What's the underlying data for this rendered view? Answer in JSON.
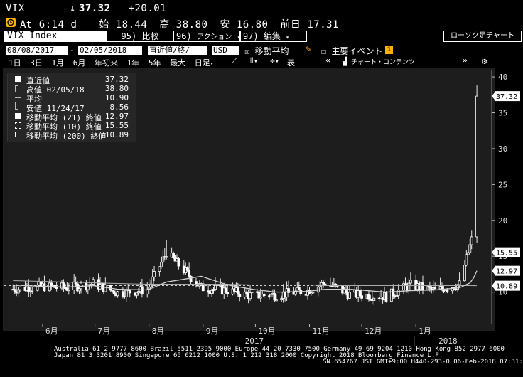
{
  "header": {
    "ticker": "VIX",
    "last_arrow": "↓",
    "last": "37.32",
    "change": "+20.01",
    "clock_icon": "clock-icon",
    "at_label": "At",
    "time": "6:14 d",
    "open_label": "始",
    "open": "18.44",
    "high_label": "高",
    "high": "38.80",
    "low_label": "安",
    "low": "16.80",
    "prev_label": "前日",
    "prev": "17.31"
  },
  "toolbar1": {
    "security": "VIX Index",
    "compare_num": "95)",
    "compare_label": "比較",
    "action_num": "96)",
    "action_label": "アクション",
    "edit_num": "97)",
    "edit_label": "編集",
    "chart_type": "ローソク足チャート"
  },
  "toolbar2": {
    "date_from": "08/08/2017",
    "date_sep": "-",
    "date_to": "02/05/2018",
    "price_field": "直近値/終/",
    "currency": "USD",
    "ma_check": "☒",
    "ma_label": "移動平均",
    "events_check": "☐",
    "events_label": "主要イベント",
    "info_icon": "i"
  },
  "toolbar3": {
    "periods": [
      "1日",
      "3日",
      "1月",
      "6月",
      "年初来",
      "1年",
      "5年",
      "最大"
    ],
    "frequency": "日足",
    "chart_contents": "チャート・コンテンツ"
  },
  "legend": [
    {
      "mark": "box",
      "label": "直近値",
      "value": "37.32"
    },
    {
      "mark": "up",
      "label": "高値 02/05/18",
      "value": "38.80"
    },
    {
      "mark": "avg",
      "label": "平均",
      "value": "10.90"
    },
    {
      "mark": "down",
      "label": "安値 11/24/17",
      "value": "8.56"
    },
    {
      "mark": "box",
      "label": "移動平均 (21) 終値",
      "value": "12.97"
    },
    {
      "mark": "dash",
      "label": "移動平均 (10) 終値",
      "value": "15.55"
    },
    {
      "mark": "half",
      "label": "移動平均 (200) 終値",
      "value": "10.89"
    }
  ],
  "chart_data": {
    "type": "line",
    "title": "",
    "xlabel": "",
    "ylabel": "",
    "y_ticks": [
      10,
      15,
      20,
      25,
      30,
      35,
      40
    ],
    "ylim": [
      5.5,
      41
    ],
    "x_months": [
      "6月",
      "7月",
      "8月",
      "9月",
      "10月",
      "11月",
      "12月",
      "1月"
    ],
    "x_years": [
      "2017",
      "2018"
    ],
    "price_labels": [
      {
        "value": 37.32,
        "text": "37.32"
      },
      {
        "value": 15.55,
        "text": "15.55"
      },
      {
        "value": 12.97,
        "text": "12.97"
      },
      {
        "value": 10.89,
        "text": "10.89"
      }
    ],
    "series": [
      {
        "name": "直近値",
        "color": "#ffffff",
        "x": [
          "2017-05-15",
          "2017-05-31",
          "2017-06-15",
          "2017-06-30",
          "2017-07-14",
          "2017-07-31",
          "2017-08-11",
          "2017-08-31",
          "2017-09-15",
          "2017-09-29",
          "2017-10-13",
          "2017-10-31",
          "2017-11-10",
          "2017-11-24",
          "2017-12-15",
          "2017-12-29",
          "2018-01-12",
          "2018-01-26",
          "2018-02-02",
          "2018-02-05"
        ],
        "values": [
          10.4,
          10.8,
          10.6,
          11.2,
          9.9,
          10.3,
          15.5,
          10.6,
          10.2,
          9.5,
          9.6,
          10.2,
          11.3,
          9.7,
          9.4,
          11.0,
          10.2,
          11.1,
          17.3,
          37.3
        ]
      },
      {
        "name": "移動平均 (21) 終値",
        "color": "#d0d0d0",
        "values": [
          11.0,
          10.8,
          10.7,
          10.9,
          10.4,
          10.3,
          11.4,
          12.2,
          11.0,
          10.4,
          10.0,
          10.1,
          10.4,
          10.4,
          10.0,
          10.2,
          10.3,
          10.6,
          11.4,
          12.97
        ]
      },
      {
        "name": "移動平均 (200) 終値",
        "color": "#aaaaaa",
        "values": [
          11.6,
          11.5,
          11.4,
          11.3,
          11.2,
          11.1,
          11.1,
          11.1,
          11.1,
          11.0,
          11.0,
          11.0,
          10.9,
          10.9,
          10.9,
          10.9,
          10.9,
          10.9,
          10.9,
          10.89
        ]
      }
    ]
  },
  "footer": {
    "line1": "Australia 61 2 9777 8600 Brazil 5511 2395 9000 Europe 44 20 7330 7500 Germany 49 69 9204 1210 Hong Kong 852 2977 6000",
    "line2": "Japan 81 3 3201 8900        Singapore 65 6212 1000       U.S. 1 212 318 2000        Copyright 2018 Bloomberg Finance L.P.",
    "line3": "SN 654767 JST  GMT+9:00 H440-293-0 06-Feb-2018 07:31:19"
  }
}
